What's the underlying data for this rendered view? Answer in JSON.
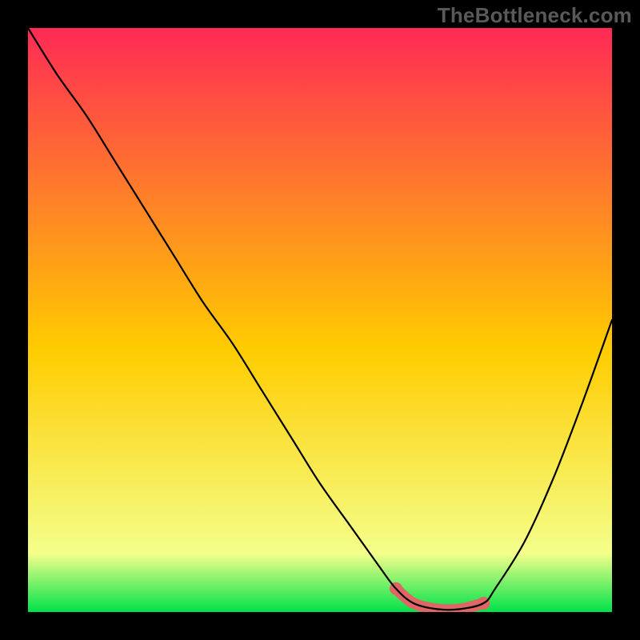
{
  "watermark": "TheBottleneck.com",
  "chart_data": {
    "type": "line",
    "title": "",
    "xlabel": "",
    "ylabel": "",
    "xlim": [
      0,
      100
    ],
    "ylim": [
      0,
      100
    ],
    "x": [
      0,
      5,
      10,
      15,
      20,
      25,
      30,
      35,
      40,
      45,
      50,
      55,
      60,
      63,
      66,
      70,
      74,
      78,
      80,
      85,
      90,
      95,
      100
    ],
    "values": [
      100,
      92,
      85,
      77,
      69,
      61,
      53,
      46,
      38,
      30,
      22,
      15,
      8,
      4,
      1.5,
      0.5,
      0.5,
      1.5,
      4,
      12,
      23,
      36,
      50
    ],
    "low_region_x": [
      63,
      78
    ],
    "gradient_top_color": "#ff2a55",
    "gradient_mid_color": "#ffcc00",
    "gradient_low_color": "#f4ff8a",
    "gradient_bottom_color": "#00e24a",
    "curve_color": "#000000",
    "low_marker_color": "#e06666"
  }
}
